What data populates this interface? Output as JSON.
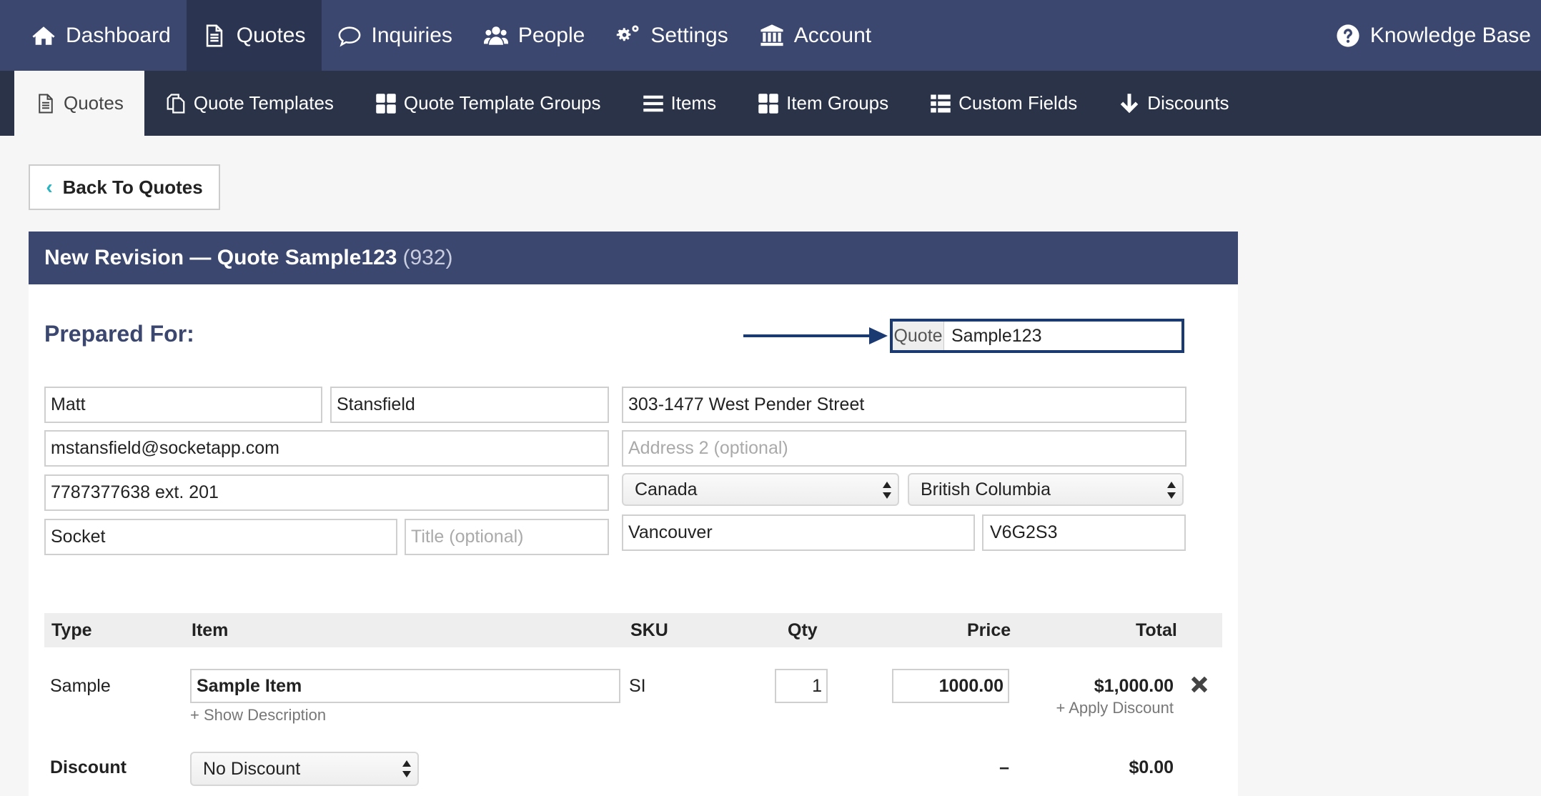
{
  "top_nav": {
    "items": [
      {
        "label": "Dashboard",
        "icon": "home-icon"
      },
      {
        "label": "Quotes",
        "icon": "document-icon",
        "active": true
      },
      {
        "label": "Inquiries",
        "icon": "chat-bubble-icon"
      },
      {
        "label": "People",
        "icon": "users-icon"
      },
      {
        "label": "Settings",
        "icon": "gears-icon"
      },
      {
        "label": "Account",
        "icon": "bank-icon"
      }
    ],
    "knowledge_base": {
      "label": "Knowledge Base",
      "icon": "question-circle-icon"
    }
  },
  "sub_nav": {
    "items": [
      {
        "label": "Quotes",
        "icon": "document-icon",
        "active": true
      },
      {
        "label": "Quote Templates",
        "icon": "copy-icon"
      },
      {
        "label": "Quote Template Groups",
        "icon": "grid-icon"
      },
      {
        "label": "Items",
        "icon": "list-icon"
      },
      {
        "label": "Item Groups",
        "icon": "grid-icon"
      },
      {
        "label": "Custom Fields",
        "icon": "list-table-icon"
      },
      {
        "label": "Discounts",
        "icon": "arrow-down-icon"
      }
    ]
  },
  "back_button": {
    "label": "Back To Quotes"
  },
  "panel": {
    "title": "New Revision — Quote Sample123",
    "number": "(932)"
  },
  "prepared_for": {
    "heading": "Prepared For:"
  },
  "quote_field": {
    "label": "Quote",
    "value": "Sample123"
  },
  "form": {
    "first_name": "Matt",
    "last_name": "Stansfield",
    "email": "mstansfield@socketapp.com",
    "phone": "7787377638 ext. 201",
    "company": "Socket",
    "title_placeholder": "Title (optional)",
    "address1": "303-1477 West Pender Street",
    "address2_placeholder": "Address 2 (optional)",
    "country": "Canada",
    "province": "British Columbia",
    "city": "Vancouver",
    "postal": "V6G2S3"
  },
  "items_table": {
    "headers": {
      "type": "Type",
      "item": "Item",
      "sku": "SKU",
      "qty": "Qty",
      "price": "Price",
      "total": "Total"
    },
    "row": {
      "type": "Sample",
      "item": "Sample Item",
      "show_description": "+ Show Description",
      "sku": "SI",
      "qty": "1",
      "price": "1000.00",
      "total": "$1,000.00",
      "apply_discount": "+ Apply Discount"
    },
    "discount_row": {
      "label": "Discount",
      "select": "No Discount",
      "price": "–",
      "total": "$0.00"
    }
  }
}
